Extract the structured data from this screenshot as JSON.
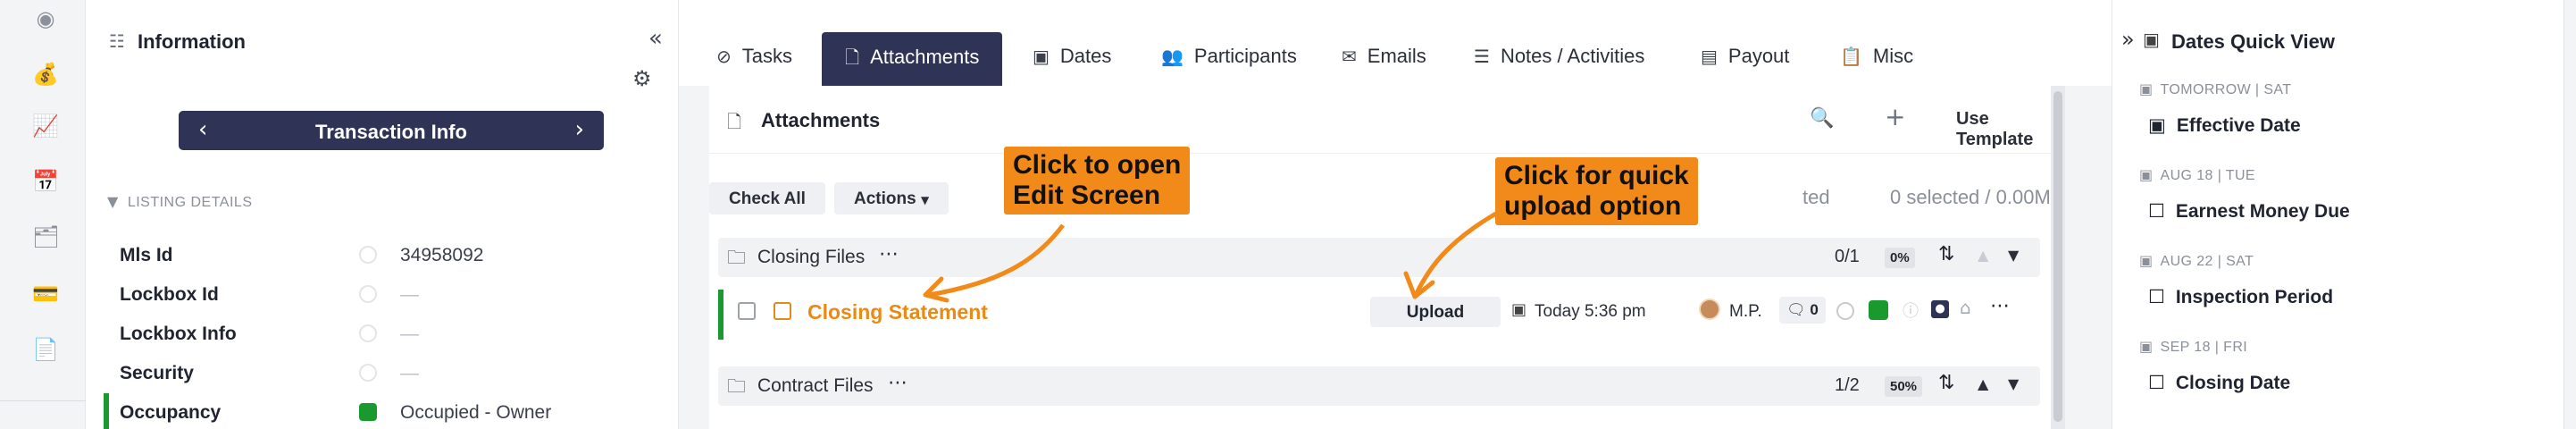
{
  "rail": {
    "icons": [
      "radio-icon",
      "money-bag-icon",
      "chart-icon",
      "calendar-icon",
      "cards-icon",
      "credit-card-icon",
      "document-icon"
    ]
  },
  "info_panel": {
    "title": "Information",
    "transaction_nav_label": "Transaction Info",
    "section": "LISTING DETAILS",
    "rows": [
      {
        "key": "Mls Id",
        "value": "34958092"
      },
      {
        "key": "Lockbox Id",
        "value": "—"
      },
      {
        "key": "Lockbox Info",
        "value": "—"
      },
      {
        "key": "Security",
        "value": "—"
      },
      {
        "key": "Occupancy",
        "value": "Occupied - Owner"
      }
    ]
  },
  "tabs": [
    {
      "label": "Tasks"
    },
    {
      "label": "Attachments"
    },
    {
      "label": "Dates"
    },
    {
      "label": "Participants"
    },
    {
      "label": "Emails"
    },
    {
      "label": "Notes / Activities"
    },
    {
      "label": "Payout"
    },
    {
      "label": "Misc"
    }
  ],
  "attachments": {
    "title": "Attachments",
    "use_template": "Use Template",
    "check_all": "Check All",
    "actions": "Actions",
    "hidden_suffix": "ted",
    "selected_info": "0 selected / 0.00MB",
    "groups": [
      {
        "name": "Closing Files",
        "count": "0/1",
        "pct": "0%"
      },
      {
        "name": "Contract Files",
        "count": "1/2",
        "pct": "50%"
      }
    ],
    "file": {
      "name": "Closing Statement",
      "upload": "Upload",
      "when": "Today 5:36 pm",
      "initials": "M.P.",
      "comments": "0"
    }
  },
  "callouts": {
    "edit": "Click to open\nEdit Screen",
    "upload": "Click for quick\nupload option"
  },
  "colors": {
    "navy": "#2f3356",
    "orange": "#f28a1a",
    "green": "#1a9a2e"
  },
  "quick_view": {
    "title": "Dates Quick View",
    "items": [
      {
        "date": "TOMORROW | SAT",
        "label": "Effective Date",
        "checked": false
      },
      {
        "date": "AUG 18 | TUE",
        "label": "Earnest Money Due",
        "checked": false
      },
      {
        "date": "AUG 22 | SAT",
        "label": "Inspection Period",
        "checked": false
      },
      {
        "date": "SEP 18 | FRI",
        "label": "Closing Date",
        "checked": false
      }
    ]
  }
}
